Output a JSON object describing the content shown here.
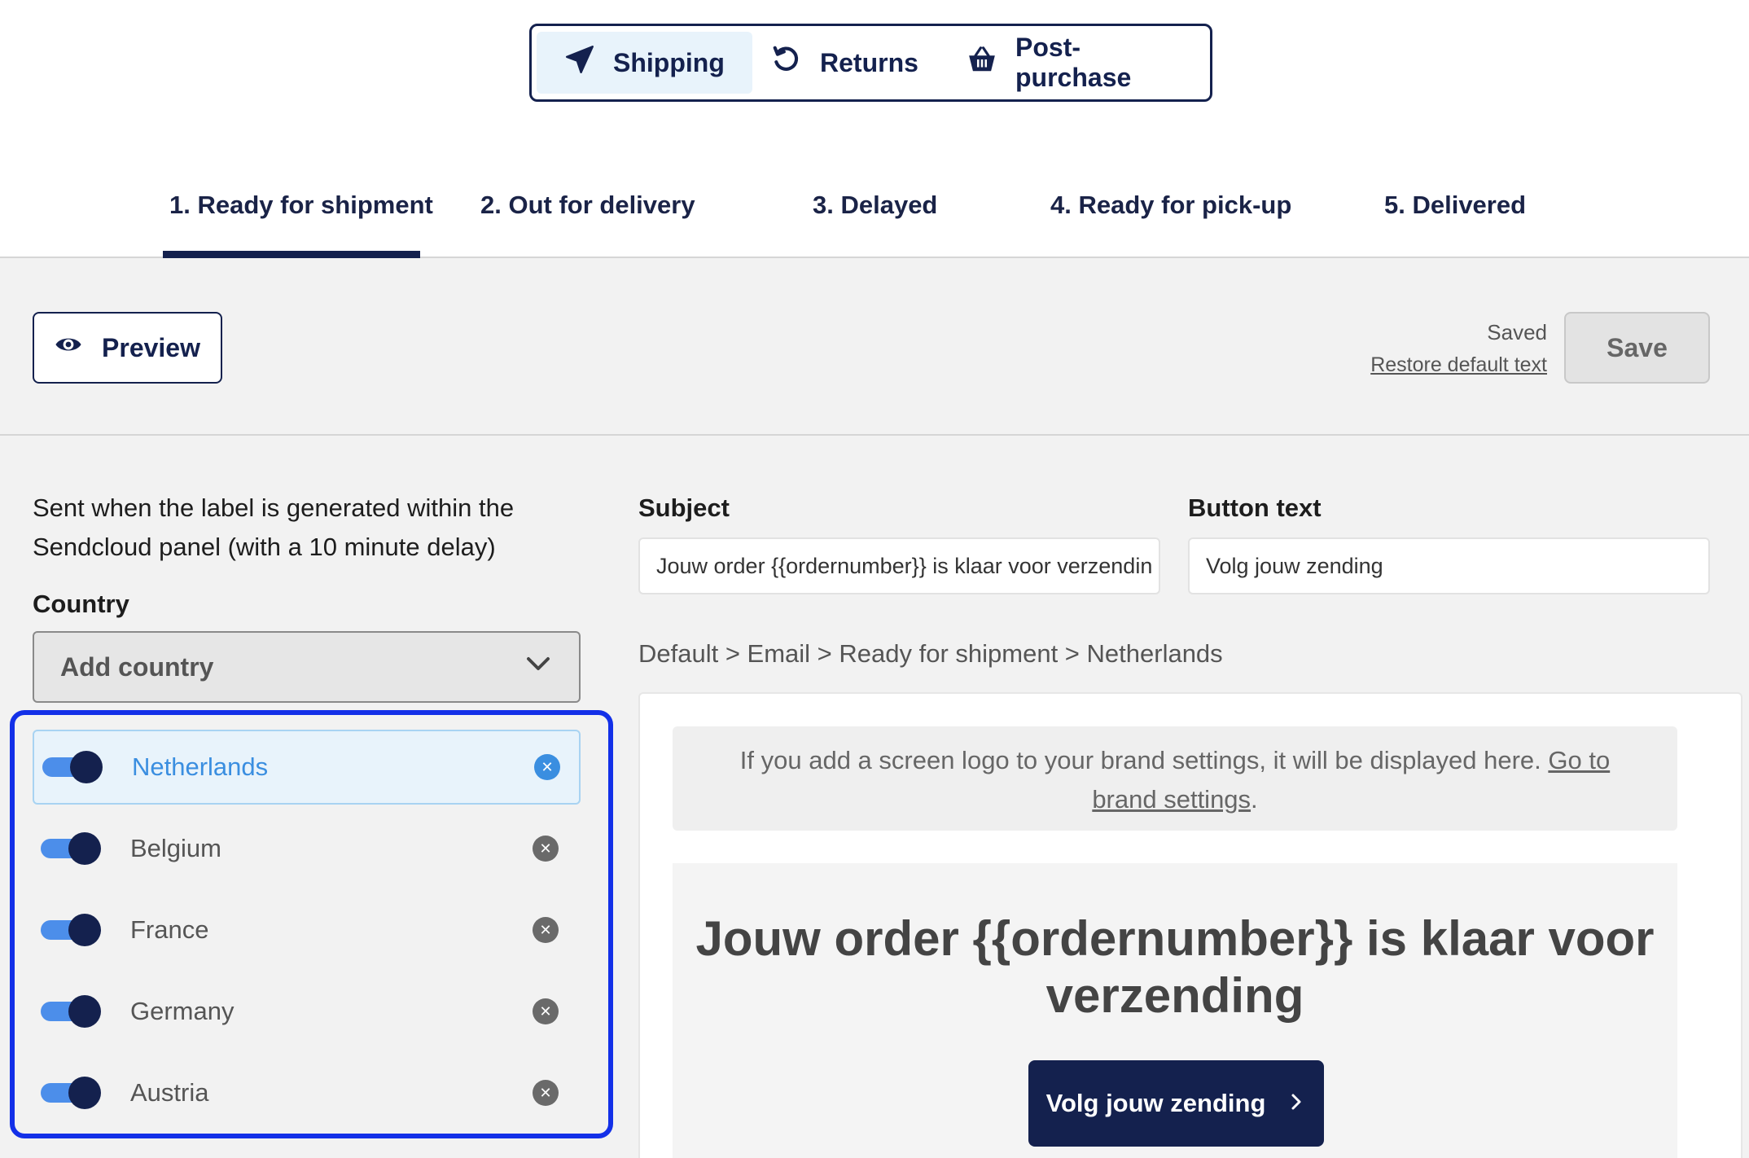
{
  "mode_tabs": [
    {
      "label": "Shipping",
      "icon": "paper-plane-icon",
      "active": true
    },
    {
      "label": "Returns",
      "icon": "return-arrow-icon",
      "active": false
    },
    {
      "label": "Post-purchase",
      "icon": "basket-icon",
      "active": false
    }
  ],
  "steps": [
    {
      "label": "1. Ready for shipment",
      "active": true
    },
    {
      "label": "2. Out for delivery",
      "active": false
    },
    {
      "label": "3. Delayed",
      "active": false
    },
    {
      "label": "4. Ready for pick-up",
      "active": false
    },
    {
      "label": "5. Delivered",
      "active": false
    }
  ],
  "toolbar": {
    "preview_label": "Preview",
    "saved_status": "Saved",
    "restore_label": "Restore default text",
    "save_label": "Save"
  },
  "left": {
    "description": "Sent when the label is generated within the Sendcloud panel (with a 10 minute delay)",
    "country_label": "Country",
    "add_country_placeholder": "Add country",
    "countries": [
      {
        "name": "Netherlands",
        "enabled": true,
        "selected": true
      },
      {
        "name": "Belgium",
        "enabled": true,
        "selected": false
      },
      {
        "name": "France",
        "enabled": true,
        "selected": false
      },
      {
        "name": "Germany",
        "enabled": true,
        "selected": false
      },
      {
        "name": "Austria",
        "enabled": true,
        "selected": false
      }
    ]
  },
  "form": {
    "subject_label": "Subject",
    "subject_value": "Jouw order {{ordernumber}} is klaar voor verzendin",
    "button_text_label": "Button text",
    "button_text_value": "Volg jouw zending"
  },
  "breadcrumb": "Default > Email > Ready for shipment > Netherlands",
  "preview": {
    "logo_note_text": "If you add a screen logo to your brand settings, it will be displayed here.",
    "logo_note_link": "Go to brand settings",
    "logo_note_end": ".",
    "email_title": "Jouw order {{ordernumber}} is klaar voor verzending",
    "cta_label": "Volg jouw zending"
  },
  "colors": {
    "brand_navy": "#14214e",
    "accent_blue": "#3a8ee0",
    "highlight_border": "#1330e8"
  }
}
